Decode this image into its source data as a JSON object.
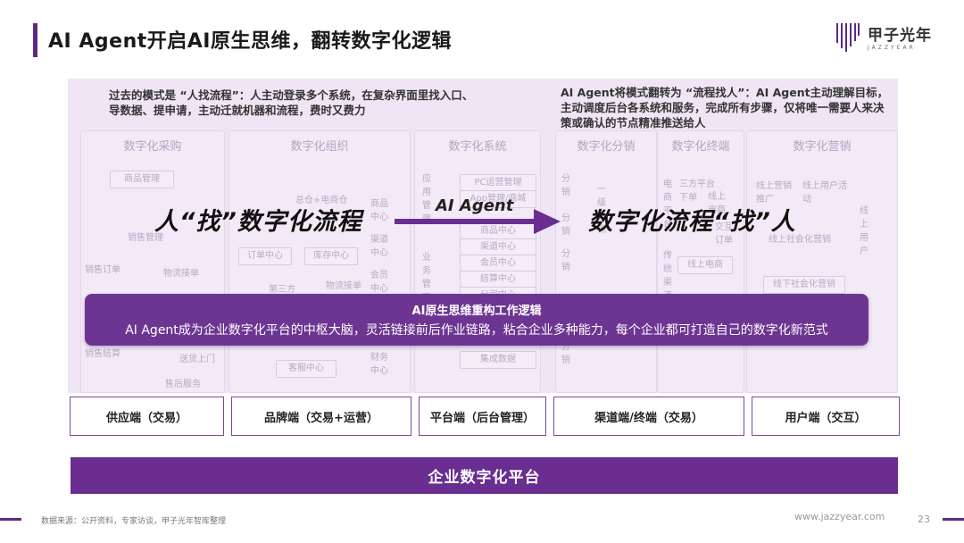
{
  "header": {
    "title": "AI Agent开启AI原生思维，翻转数字化逻辑",
    "logo_cn": "甲子光年",
    "logo_en": "JAZZYEAR"
  },
  "notes": {
    "left": "过去的模式是 “人找流程”：人主动登录多个系统，在复杂界面里找入口、导数据、提申请，主动迁就机器和流程，费时又费力",
    "right": "AI Agent将模式翻转为 “流程找人”：AI Agent主动理解目标，主动调度后台各系统和服务，完成所有步骤，仅将唯一需要人来决策或确认的节点精准推送给人"
  },
  "columns": [
    {
      "head": "数字化采购"
    },
    {
      "head": "数字化组织"
    },
    {
      "head": "数字化系统"
    },
    {
      "head": "数字化分销"
    },
    {
      "head": "数字化终端"
    },
    {
      "head": "数字化营销"
    }
  ],
  "faint": {
    "procurement": [
      "商品管理",
      "销售管理",
      "销售订单",
      "物流接单",
      "送货上门",
      "售后服务",
      "销售结算"
    ],
    "org": [
      "总仓+电商仓",
      "商品中心",
      "订单中心",
      "库存中心",
      "渠道中心",
      "第三方",
      "物流接单",
      "会员中心",
      "客服中心",
      "财务中心"
    ],
    "system": [
      "应用管理",
      "PC运营管理",
      "App管理/商城",
      "商品中心",
      "渠道中心",
      "会员中心",
      "结算中心",
      "分润中心",
      "业务管理",
      "集成数据"
    ],
    "distribution": [
      "分销",
      "分销",
      "分销",
      "分销",
      "分销",
      "一级分销"
    ],
    "terminal": [
      "电商平台",
      "三方平台下单",
      "线上电商",
      "交互订单",
      "线上电商",
      "传统渠道"
    ],
    "marketing": [
      "线上营销推广",
      "线上用户活动",
      "线上用户",
      "线上社会化营销",
      "线下社会化营销"
    ]
  },
  "center": {
    "left_phrase": "人“找”数字化流程",
    "arrow_label": "AI Agent",
    "right_phrase": "数字化流程“找”人"
  },
  "rebuild": {
    "title": "AI原生思维重构工作逻辑",
    "desc": "AI Agent成为企业数字化平台的中枢大脑，灵活链接前后作业链路，粘合企业多种能力，每个企业都可打造自己的数字化新范式"
  },
  "pillars": [
    "供应端（交易）",
    "品牌端（交易+运营）",
    "平台端（后台管理）",
    "渠道端/终端（交易）",
    "用户端（交互）"
  ],
  "platform": "企业数字化平台",
  "footer": {
    "source": "数据来源：公开资料，专家访谈，甲子光年智库整理",
    "site": "www.jazzyear.com",
    "page": "23"
  },
  "colors": {
    "accent": "#5b2a86",
    "platform": "#6a2e91",
    "panel": "#efe5f4"
  }
}
